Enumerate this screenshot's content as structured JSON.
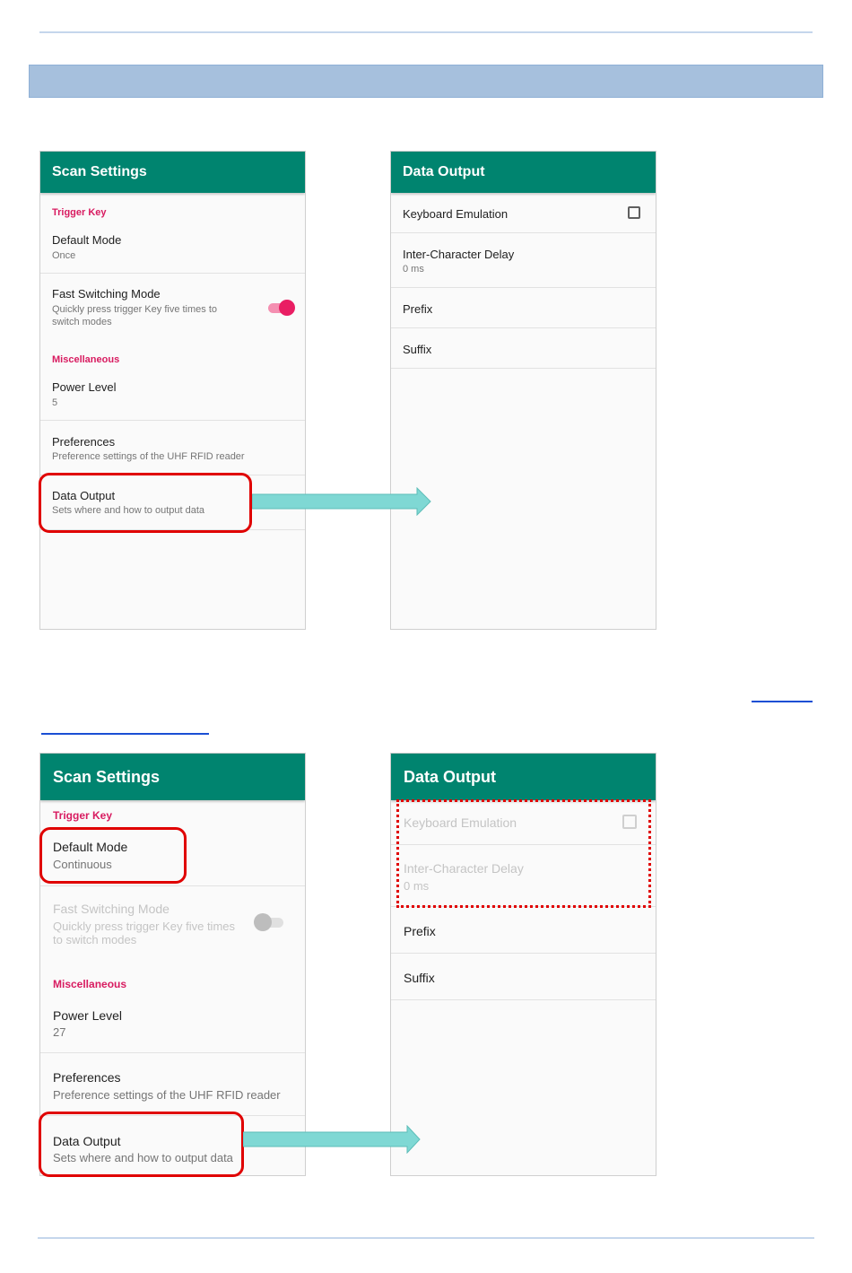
{
  "top": {
    "scan_settings": {
      "title": "Scan Settings",
      "cat_trigger": "Trigger Key",
      "default_mode_title": "Default Mode",
      "default_mode_value": "Once",
      "fast_switch_title": "Fast Switching Mode",
      "fast_switch_sub": "Quickly press trigger Key five times to switch modes",
      "cat_misc": "Miscellaneous",
      "power_title": "Power Level",
      "power_value": "5",
      "pref_title": "Preferences",
      "pref_sub": "Preference settings of the UHF RFID reader",
      "output_title": "Data Output",
      "output_sub": "Sets where and how to output data"
    },
    "data_output": {
      "title": "Data Output",
      "keyboard": "Keyboard Emulation",
      "delay_title": "Inter-Character Delay",
      "delay_value": "0 ms",
      "prefix": "Prefix",
      "suffix": "Suffix"
    }
  },
  "bottom": {
    "scan_settings": {
      "title": "Scan Settings",
      "cat_trigger": "Trigger Key",
      "default_mode_title": "Default Mode",
      "default_mode_value": "Continuous",
      "fast_switch_title": "Fast Switching Mode",
      "fast_switch_sub": "Quickly press trigger Key five times to switch modes",
      "cat_misc": "Miscellaneous",
      "power_title": "Power Level",
      "power_value": "27",
      "pref_title": "Preferences",
      "pref_sub": "Preference settings of the UHF RFID reader",
      "output_title": "Data Output",
      "output_sub": "Sets where and how to output data"
    },
    "data_output": {
      "title": "Data Output",
      "keyboard": "Keyboard Emulation",
      "delay_title": "Inter-Character Delay",
      "delay_value": "0 ms",
      "prefix": "Prefix",
      "suffix": "Suffix"
    }
  },
  "colors": {
    "appbar": "#00846f",
    "category": "#d81b60",
    "switch_on": "#e91e63",
    "highlight": "#e00000",
    "arrow": "#7fd8d4",
    "banner": "#a6c0dd"
  },
  "toggles": {
    "top_fast_switching": true,
    "bottom_fast_switching": false
  }
}
